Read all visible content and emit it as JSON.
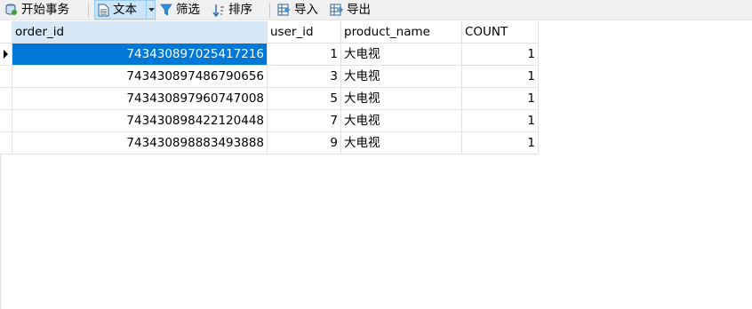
{
  "toolbar": {
    "begin_transaction": "开始事务",
    "text": "文本",
    "filter": "筛选",
    "sort": "排序",
    "import": "导入",
    "export": "导出"
  },
  "table": {
    "columns": [
      "order_id",
      "user_id",
      "product_name",
      "COUNT"
    ],
    "rows": [
      {
        "order_id": "743430897025417216",
        "user_id": "1",
        "product_name": "大电视",
        "count": "1"
      },
      {
        "order_id": "743430897486790656",
        "user_id": "3",
        "product_name": "大电视",
        "count": "1"
      },
      {
        "order_id": "743430897960747008",
        "user_id": "5",
        "product_name": "大电视",
        "count": "1"
      },
      {
        "order_id": "743430898422120448",
        "user_id": "7",
        "product_name": "大电视",
        "count": "1"
      },
      {
        "order_id": "743430898883493888",
        "user_id": "9",
        "product_name": "大电视",
        "count": "1"
      }
    ]
  },
  "colors": {
    "selection": "#0078d7",
    "header_selected": "#d7e8f7",
    "active_tool": "#cce4f7"
  }
}
